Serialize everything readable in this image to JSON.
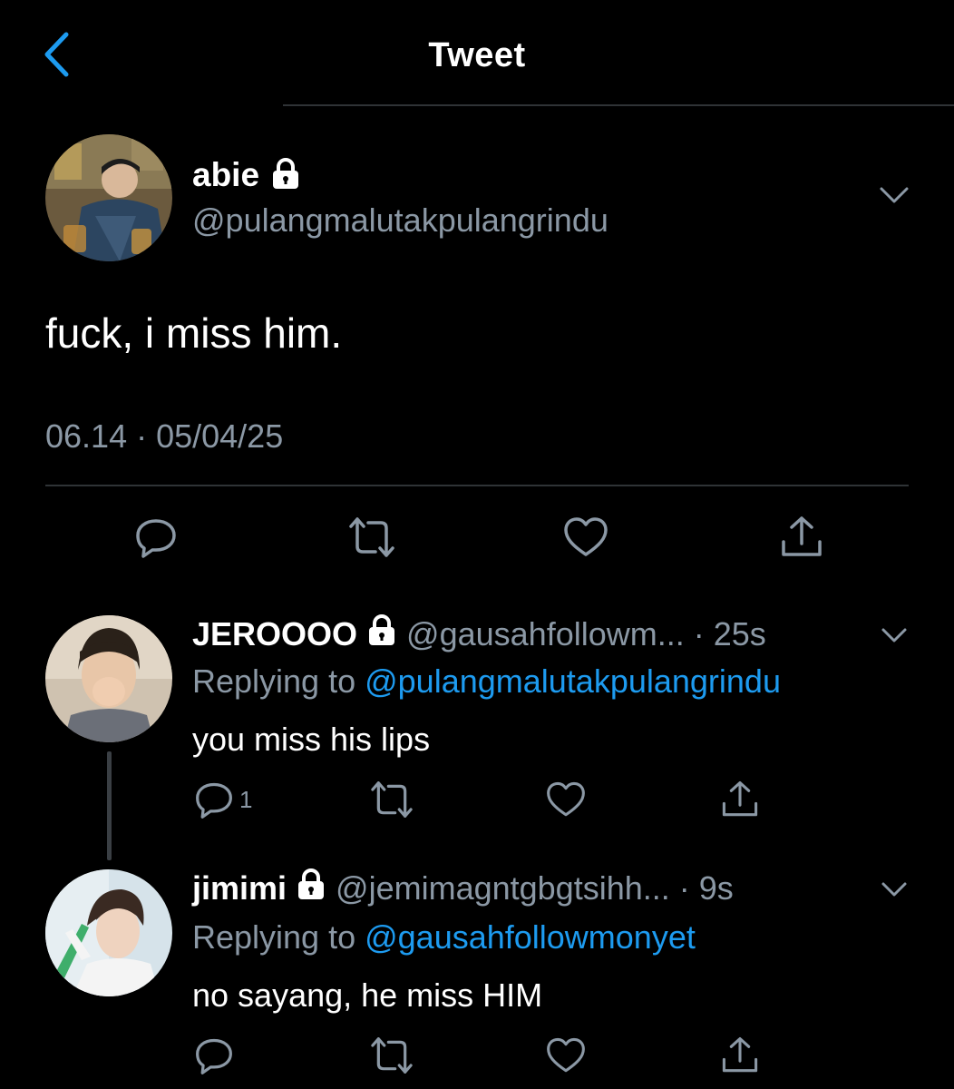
{
  "header": {
    "title": "Tweet",
    "back_icon": "chevron-left-icon"
  },
  "main_tweet": {
    "name": "abie",
    "handle": "@pulangmalutakpulangrindu",
    "text": "fuck, i miss him.",
    "meta": "06.14 · 05/04/25",
    "protected": true
  },
  "replies": [
    {
      "name": "JEROOOO",
      "handle": "@gausahfollowm...",
      "time": "· 25s",
      "replying_prefix": "Replying to ",
      "replying_to": "@pulangmalutakpulangrindu",
      "text": "you miss his lips",
      "reply_count": "1"
    },
    {
      "name": "jimimi",
      "handle": "@jemimagntgbgtsihh...",
      "time": " · 9s",
      "replying_prefix": "Replying to ",
      "replying_to": "@gausahfollowmonyet",
      "text": "no sayang, he miss HIM",
      "reply_count": ""
    }
  ],
  "colors": {
    "accent": "#1d9bf0",
    "muted": "#8b98a5",
    "divider": "#2f3336",
    "background": "#000000"
  }
}
